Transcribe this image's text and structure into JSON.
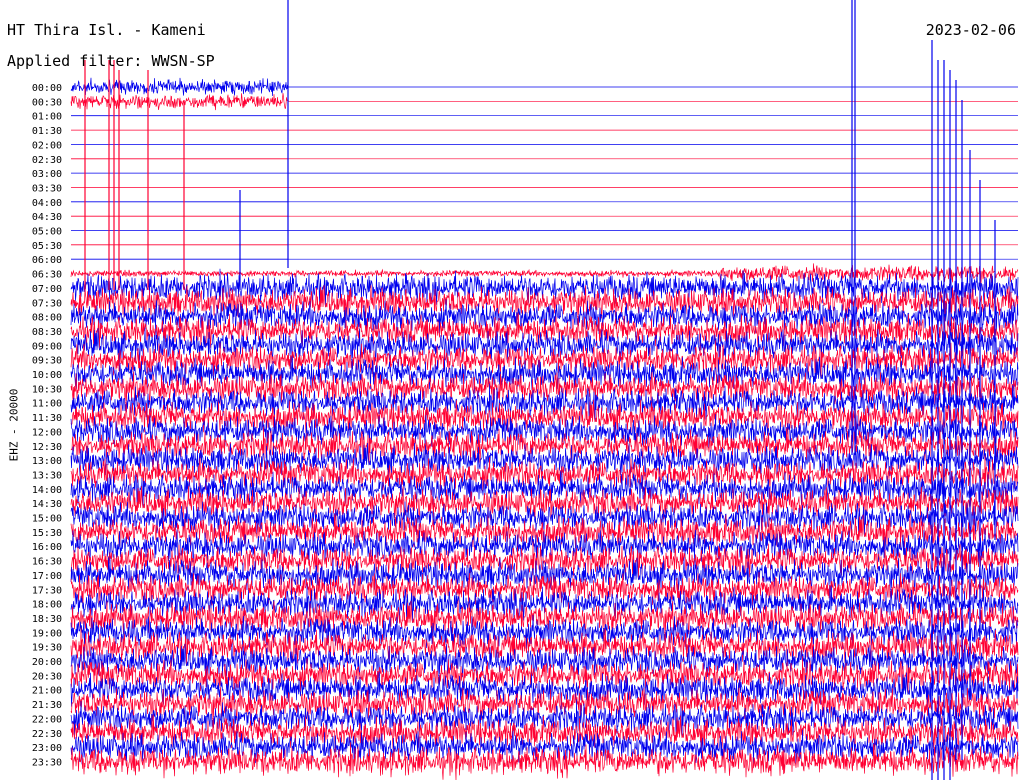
{
  "header": {
    "station": "HT Thira Isl. - Kameni",
    "filter": "Applied filter: WWSN-SP",
    "date": "2023-02-06"
  },
  "channel_label": "EHZ - 20000",
  "colors": {
    "blue": "#0000ee",
    "red": "#ff0033",
    "background": "#ffffff"
  },
  "chart_data": {
    "type": "line",
    "title": "HT Thira Isl. - Kameni",
    "ylabel": "EHZ - 20000",
    "rows": [
      "00:00",
      "00:30",
      "01:00",
      "01:30",
      "02:00",
      "02:30",
      "03:00",
      "03:30",
      "04:00",
      "04:30",
      "05:00",
      "05:30",
      "06:00",
      "06:30",
      "07:00",
      "07:30",
      "08:00",
      "08:30",
      "09:00",
      "09:30",
      "10:00",
      "10:30",
      "11:00",
      "11:30",
      "12:00",
      "12:30",
      "13:00",
      "13:30",
      "14:00",
      "14:30",
      "15:00",
      "15:30",
      "16:00",
      "16:30",
      "17:00",
      "17:30",
      "18:00",
      "18:30",
      "19:00",
      "19:30",
      "20:00",
      "20:30",
      "21:00",
      "21:30",
      "22:00",
      "22:30",
      "23:00",
      "23:30"
    ],
    "row_minutes": 30,
    "series_colors": [
      "#0000ee",
      "#ff0033"
    ],
    "quiet_rows": [
      "01:00",
      "01:30",
      "02:00",
      "02:30",
      "03:00",
      "03:30",
      "04:00",
      "04:30",
      "05:00",
      "05:30",
      "06:00"
    ],
    "grid": false
  }
}
